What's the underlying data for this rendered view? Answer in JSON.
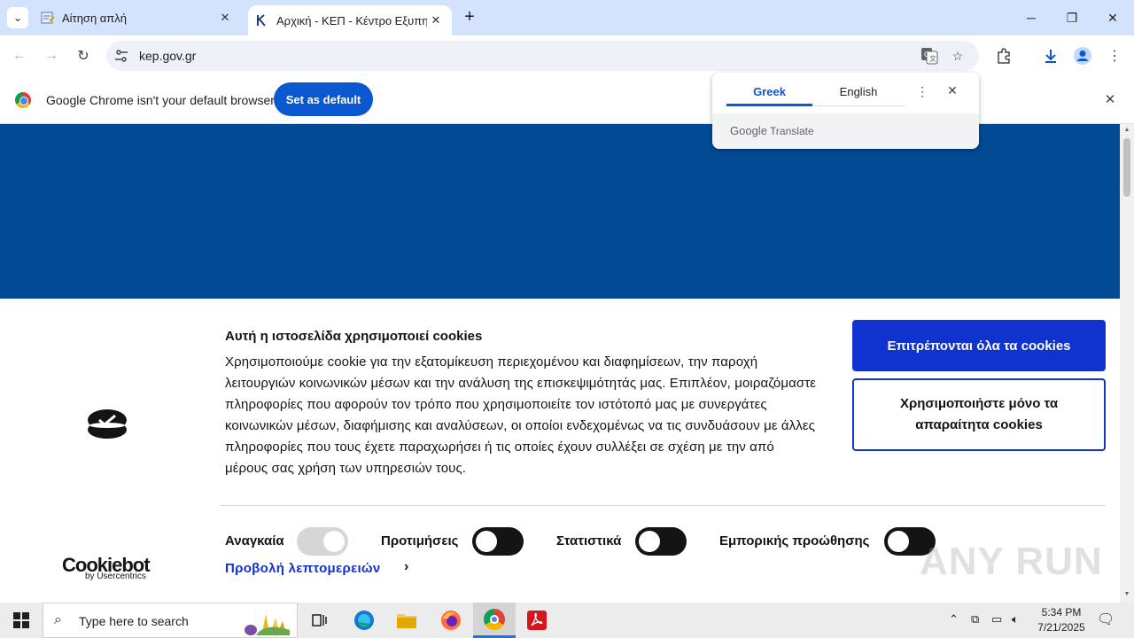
{
  "browser": {
    "tabs": [
      {
        "title": "Αίτηση απλή",
        "favicon": "form-icon"
      },
      {
        "title": "Αρχική - ΚΕΠ - Κέντρο Εξυπηρέτησης",
        "favicon": "kep-icon"
      }
    ],
    "url": "kep.gov.gr",
    "infobar": {
      "message": "Google Chrome isn't your default browser",
      "button": "Set as default"
    }
  },
  "translate_popup": {
    "source_lang": "Greek",
    "target_lang": "English",
    "brand_google": "Google",
    "brand_translate": "Translate"
  },
  "cookie_banner": {
    "heading": "Αυτή η ιστοσελίδα χρησιμοποιεί cookies",
    "body": "Χρησιμοποιούμε cookie για την εξατομίκευση περιεχομένου και διαφημίσεων, την παροχή λειτουργιών κοινωνικών μέσων και την ανάλυση της επισκεψιμότητάς μας. Επιπλέον, μοιραζόμαστε πληροφορίες που αφορούν τον τρόπο που χρησιμοποιείτε τον ιστότοπό μας με συνεργάτες κοινωνικών μέσων, διαφήμισης και αναλύσεων, οι οποίοι ενδεχομένως να τις συνδυάσουν με άλλες πληροφορίες που τους έχετε παραχωρήσει ή τις οποίες έχουν συλλέξει σε σχέση με την από μέρους σας χρήση των υπηρεσιών τους.",
    "allow_all": "Επιτρέπονται όλα τα cookies",
    "necessary_only": "Χρησιμοποιήστε μόνο τα απαραίτητα cookies",
    "categories": [
      {
        "label": "Αναγκαία",
        "enabled": true,
        "disabled": true
      },
      {
        "label": "Προτιμήσεις",
        "enabled": false
      },
      {
        "label": "Στατιστικά",
        "enabled": false
      },
      {
        "label": "Εμπορικής προώθησης",
        "enabled": false
      }
    ],
    "details_link": "Προβολή λεπτομερειών",
    "brand": "Cookiebot",
    "brand_sub": "by Usercentrics"
  },
  "watermark": "ANY RUN",
  "taskbar": {
    "search_placeholder": "Type here to search",
    "time": "5:34 PM",
    "date": "7/21/2025"
  },
  "colors": {
    "banner": "#034a94",
    "primary_button": "#1032cf",
    "chrome_accent": "#0b57d0"
  }
}
